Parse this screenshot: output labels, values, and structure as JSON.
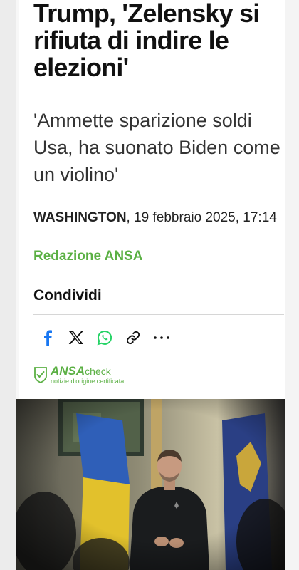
{
  "article": {
    "headline": "Trump, 'Zelensky si rifiuta di indire le elezioni'",
    "subtitle": "'Ammette sparizione soldi Usa, ha suonato Biden come un violino'",
    "place": "WASHINGTON",
    "datetime": ", 19 febbraio 2025, 17:14",
    "author": "Redazione ANSA"
  },
  "share": {
    "title": "Condividi",
    "buttons": [
      "facebook-icon",
      "x-icon",
      "whatsapp-icon",
      "link-icon",
      "more-icon"
    ]
  },
  "ansa_check": {
    "brand": "ANSA",
    "suffix": "check",
    "tagline": "notizie d'origine certificata"
  },
  "colors": {
    "accent_green": "#5bb044",
    "facebook_blue": "#1877f2",
    "whatsapp_green": "#25d366"
  },
  "photo": {
    "icon": "photo-zelensky-press-conference"
  }
}
